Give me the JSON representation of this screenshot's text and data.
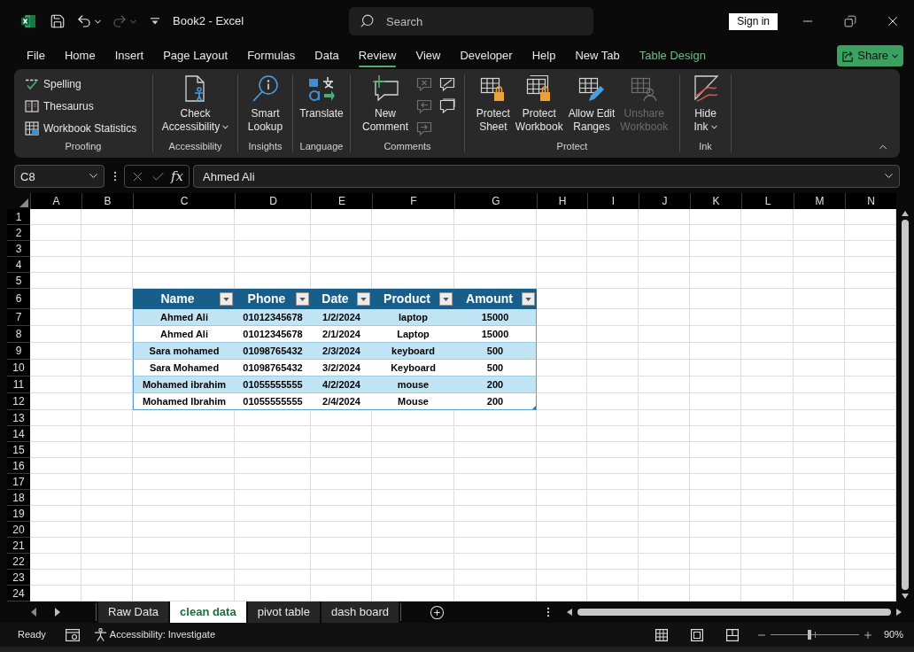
{
  "title_bar": {
    "quick_access": [
      {
        "kind": "save",
        "disabled": false
      },
      {
        "kind": "undo",
        "disabled": false
      },
      {
        "kind": "redo",
        "disabled": true
      }
    ],
    "title": "Book2 - Excel",
    "search": {
      "placeholder": "Search"
    },
    "sign_in": "Sign in"
  },
  "menu_tabs": [
    {
      "label": "File",
      "kind": "standard",
      "selected": false
    },
    {
      "label": "Home",
      "kind": "standard",
      "selected": false
    },
    {
      "label": "Insert",
      "kind": "standard",
      "selected": false
    },
    {
      "label": "Page Layout",
      "kind": "standard",
      "selected": false
    },
    {
      "label": "Formulas",
      "kind": "standard",
      "selected": false
    },
    {
      "label": "Data",
      "kind": "standard",
      "selected": false
    },
    {
      "label": "Review",
      "kind": "standard",
      "selected": true
    },
    {
      "label": "View",
      "kind": "standard",
      "selected": false
    },
    {
      "label": "Developer",
      "kind": "standard",
      "selected": false
    },
    {
      "label": "Help",
      "kind": "standard",
      "selected": false
    },
    {
      "label": "New Tab",
      "kind": "standard",
      "selected": false
    },
    {
      "label": "Table Design",
      "kind": "contextual",
      "selected": false
    }
  ],
  "share_button": {
    "label": "Share"
  },
  "ribbon": {
    "groups": [
      {
        "label": "Proofing",
        "buttons": [
          {
            "kind": "small",
            "label": "Spelling",
            "disabled": false
          },
          {
            "kind": "small",
            "label": "Thesaurus",
            "disabled": false
          },
          {
            "kind": "small",
            "label": "Workbook Statistics",
            "disabled": false
          }
        ]
      },
      {
        "label": "Accessibility",
        "buttons": [
          {
            "kind": "large",
            "lines": [
              "Check",
              "Accessibility"
            ],
            "dropdown": true,
            "disabled": false
          }
        ]
      },
      {
        "label": "Insights",
        "buttons": [
          {
            "kind": "large",
            "lines": [
              "Smart",
              "Lookup"
            ],
            "dropdown": false,
            "disabled": false
          }
        ]
      },
      {
        "label": "Language",
        "buttons": [
          {
            "kind": "large",
            "lines": [
              "Translate"
            ],
            "dropdown": false,
            "disabled": false
          }
        ]
      },
      {
        "label": "Comments",
        "buttons": [
          {
            "kind": "large",
            "lines": [
              "New",
              "Comment"
            ],
            "dropdown": false,
            "disabled": false
          },
          {
            "kind": "icon",
            "disabled": true
          },
          {
            "kind": "icon",
            "disabled": false
          },
          {
            "kind": "icon",
            "disabled": true
          },
          {
            "kind": "icon",
            "disabled": false
          },
          {
            "kind": "icon",
            "disabled": true
          }
        ]
      },
      {
        "label": "Protect",
        "buttons": [
          {
            "kind": "large",
            "lines": [
              "Protect",
              "Sheet"
            ],
            "dropdown": false,
            "disabled": false
          },
          {
            "kind": "large",
            "lines": [
              "Protect",
              "Workbook"
            ],
            "dropdown": false,
            "disabled": false
          },
          {
            "kind": "large",
            "lines": [
              "Allow Edit",
              "Ranges"
            ],
            "dropdown": false,
            "disabled": false
          },
          {
            "kind": "large",
            "lines": [
              "Unshare",
              "Workbook"
            ],
            "dropdown": false,
            "disabled": true
          }
        ]
      },
      {
        "label": "Ink",
        "buttons": [
          {
            "kind": "large",
            "lines": [
              "Hide",
              "Ink"
            ],
            "dropdown": true,
            "disabled": false
          }
        ]
      }
    ]
  },
  "formula_bar": {
    "name_box": "C8",
    "function_label": "fx",
    "formula": "Ahmed Ali"
  },
  "sheet": {
    "column_headers": [
      "A",
      "B",
      "C",
      "D",
      "E",
      "F",
      "G",
      "H",
      "I",
      "J",
      "K",
      "L",
      "M",
      "N"
    ],
    "row_headers": [
      "1",
      "2",
      "3",
      "4",
      "5",
      "6",
      "7",
      "8",
      "9",
      "10",
      "11",
      "12",
      "13",
      "14",
      "15",
      "16",
      "17",
      "18",
      "19",
      "20",
      "21",
      "22",
      "23",
      "24"
    ],
    "table": {
      "headers": [
        "Name",
        "Phone",
        "Date",
        "Product",
        "Amount"
      ],
      "rows": [
        [
          "Ahmed Ali",
          "01012345678",
          "1/2/2024",
          "laptop",
          "15000"
        ],
        [
          "Ahmed Ali",
          "01012345678",
          "2/1/2024",
          "Laptop",
          "15000"
        ],
        [
          "Sara mohamed",
          "01098765432",
          "2/3/2024",
          "keyboard",
          "500"
        ],
        [
          "Sara Mohamed",
          "01098765432",
          "3/2/2024",
          "Keyboard",
          "500"
        ],
        [
          "Mohamed ibrahim",
          "01055555555",
          "4/2/2024",
          "mouse",
          "200"
        ],
        [
          "Mohamed Ibrahim",
          "01055555555",
          "2/4/2024",
          "Mouse",
          "200"
        ]
      ]
    }
  },
  "sheet_tabs": [
    {
      "label": "Raw Data",
      "selected": false
    },
    {
      "label": "clean data",
      "selected": true
    },
    {
      "label": "pivot table",
      "selected": false
    },
    {
      "label": "dash board",
      "selected": false
    }
  ],
  "status_bar": {
    "status": "Ready",
    "accessibility": "Accessibility: Investigate",
    "zoom": {
      "level": 0.44,
      "reading": "90%"
    }
  }
}
